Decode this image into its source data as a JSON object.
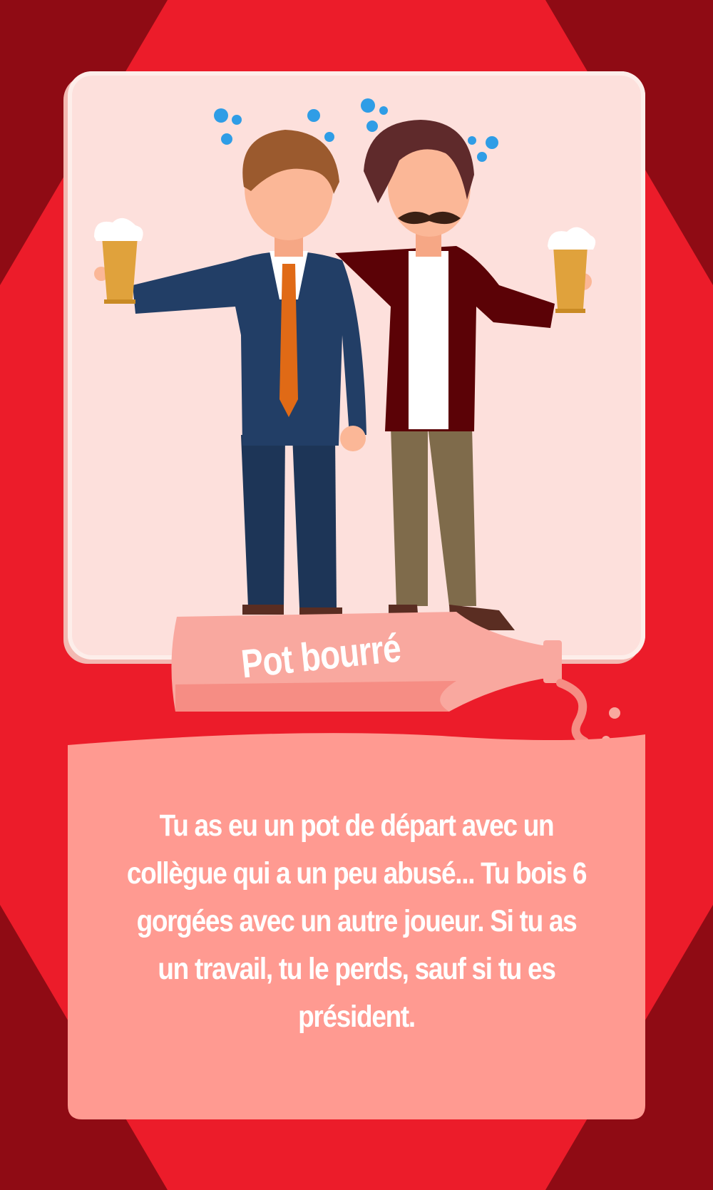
{
  "card": {
    "title": "Pot bourré",
    "description": "Tu as eu un pot de départ avec un collègue qui a un peu abusé... Tu bois 6 gorgées avec un autre joueur. Si tu as un travail, tu le perds, sauf si tu es président."
  },
  "illustration": {
    "characters": [
      "man-in-suit",
      "man-with-mustache"
    ],
    "objects": [
      "beer-glass",
      "beer-glass",
      "wine-bottle",
      "dizzy-bubbles"
    ]
  },
  "colors": {
    "background_outer": "#8f0b14",
    "background_inner": "#ec1c2a",
    "illustration_card": "#fde0dc",
    "text_panel": "#ff9a91",
    "bottle": "#f9a89f",
    "text": "#ffffff"
  }
}
